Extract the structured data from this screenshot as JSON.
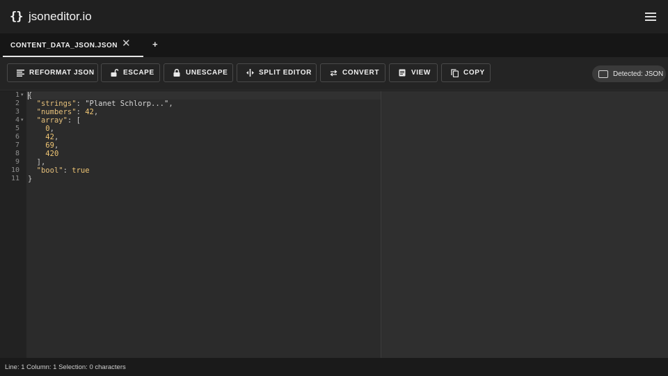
{
  "app": {
    "brand": "jsoneditor.io",
    "logo_text": "{}"
  },
  "header": {
    "menu_icon": "hamburger-menu-icon"
  },
  "tabs": [
    {
      "label": "CONTENT_DATA_JSON.JSON",
      "close": "✕"
    }
  ],
  "tab_add": "+",
  "toolbar": {
    "buttons": [
      {
        "label": "REFORMAT JSON",
        "icon": "align-left-icon"
      },
      {
        "label": "ESCAPE",
        "icon": "unlock-icon"
      },
      {
        "label": "UNESCAPE",
        "icon": "lock-icon"
      },
      {
        "label": "SPLIT EDITOR",
        "icon": "split-icon"
      },
      {
        "label": "CONVERT",
        "icon": "swap-icon"
      },
      {
        "label": "VIEW",
        "icon": "document-icon"
      },
      {
        "label": "COPY",
        "icon": "copy-icon"
      }
    ],
    "detected": "Detected: JSON"
  },
  "editor": {
    "lines": [
      {
        "num": "1",
        "fold": true
      },
      {
        "num": "2"
      },
      {
        "num": "3"
      },
      {
        "num": "4",
        "fold": true
      },
      {
        "num": "5"
      },
      {
        "num": "6"
      },
      {
        "num": "7"
      },
      {
        "num": "8"
      },
      {
        "num": "9"
      },
      {
        "num": "10"
      },
      {
        "num": "11"
      }
    ],
    "code": {
      "strings_key": "\"strings\"",
      "strings_val": "\"Planet Schlorp...\"",
      "numbers_key": "\"numbers\"",
      "numbers_val": "42",
      "array_key": "\"array\"",
      "array_items": [
        "0",
        "42",
        "69",
        "420"
      ],
      "bool_key": "\"bool\"",
      "bool_val": "true"
    }
  },
  "status": {
    "text": "Line: 1 Column: 1 Selection: 0 characters"
  }
}
